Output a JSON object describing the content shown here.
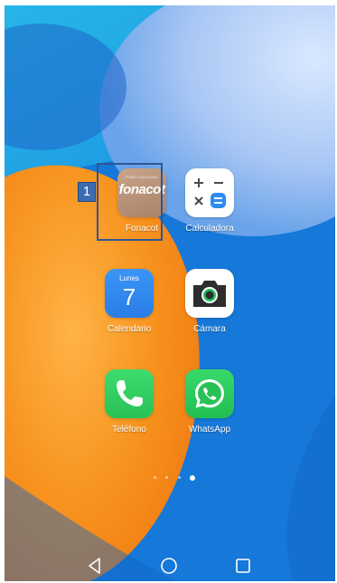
{
  "apps": {
    "fonacot": {
      "label": "Fonacot",
      "logo_text": "fonacot",
      "logo_small": "FONDO NACIONAL"
    },
    "calculadora": {
      "label": "Calculadora"
    },
    "calendario": {
      "label": "Calendario",
      "weekday": "Lunes",
      "day": "7"
    },
    "camara": {
      "label": "Cámara"
    },
    "telefono": {
      "label": "Teléfono"
    },
    "whatsapp": {
      "label": "WhatsApp"
    }
  },
  "annotation": {
    "badge_number": "1",
    "highlight_color": "#2f5597"
  },
  "page_indicator": {
    "pages": 4,
    "active_page": 4
  },
  "navigation": {
    "icons": [
      "back-icon",
      "home-icon",
      "recents-icon"
    ]
  },
  "colors": {
    "wallpaper_blue": "#1678d8",
    "wallpaper_orange": "#f7931e",
    "accent_green": "#29c156",
    "calendar_blue": "#3b95f6"
  }
}
